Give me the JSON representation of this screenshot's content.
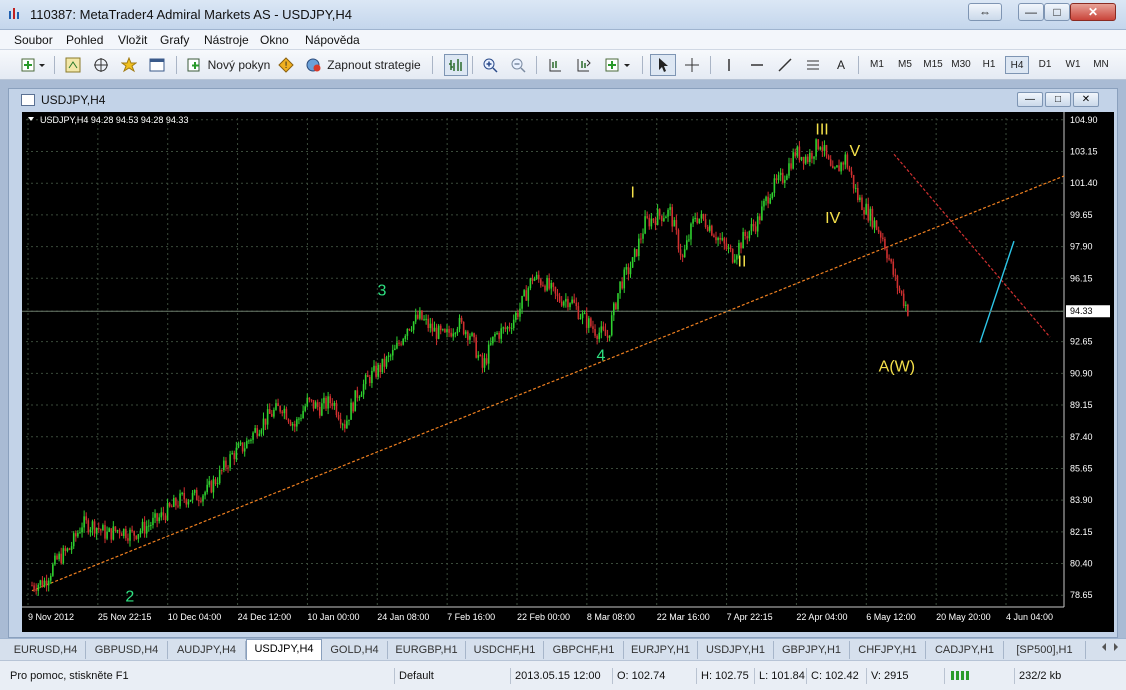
{
  "window": {
    "title": "110387: MetaTrader4 Admiral Markets AS - USDJPY,H4",
    "restore_glyph": "⇔",
    "min_glyph": "—",
    "max_glyph": "□",
    "close_glyph": "✕"
  },
  "menu": [
    "Soubor",
    "Pohled",
    "Vložit",
    "Grafy",
    "Nástroje",
    "Okno",
    "Nápověda"
  ],
  "toolbar": {
    "new_order": "Nový pokyn",
    "strategy": "Zapnout strategie",
    "text_tool": "A",
    "timeframes": [
      "M1",
      "M5",
      "M15",
      "M30",
      "H1",
      "H4",
      "D1",
      "W1",
      "MN"
    ],
    "active_timeframe": "H4"
  },
  "chart_window": {
    "title": "USDJPY,H4",
    "min_glyph": "—",
    "max_glyph": "□",
    "close_glyph": "✕"
  },
  "chart_data": {
    "type": "line",
    "symbol_header": "USDJPY,H4  94.28 94.53 94.28 94.33",
    "current_price": "94.33",
    "ylim": [
      78.0,
      105.0
    ],
    "y_ticks": [
      "104.90",
      "103.15",
      "101.40",
      "99.65",
      "97.90",
      "96.15",
      "94.33",
      "92.65",
      "90.90",
      "89.15",
      "87.40",
      "85.65",
      "83.90",
      "82.15",
      "80.40",
      "78.65"
    ],
    "x_ticks": [
      "9 Nov 2012",
      "25 Nov 22:15",
      "10 Dec 04:00",
      "24 Dec 12:00",
      "10 Jan 00:00",
      "24 Jan 08:00",
      "7 Feb 16:00",
      "22 Feb 00:00",
      "8 Mar 08:00",
      "22 Mar 16:00",
      "7 Apr 22:15",
      "22 Apr 04:00",
      "6 May 12:00",
      "20 May 20:00",
      "4 Jun 04:00"
    ],
    "series": [
      {
        "values": [
          79.2,
          79.4,
          80.6,
          81.2,
          82.6,
          82.5,
          82.0,
          82.3,
          82.0,
          82.4,
          82.8,
          83.4,
          84.0,
          84.1,
          84.4,
          85.3,
          86.4,
          86.9,
          87.9,
          88.6,
          89.1,
          88.0,
          89.3,
          89.0,
          89.4,
          88.1,
          89.8,
          90.7,
          91.3,
          92.1,
          93.5,
          94.0,
          93.3,
          92.9,
          93.7,
          93.1,
          91.2,
          93.0,
          93.4,
          94.5,
          96.2,
          95.9,
          95.0,
          95.0,
          94.0,
          93.3,
          92.9,
          95.8,
          97.0,
          99.2,
          99.6,
          99.8,
          97.2,
          99.6,
          99.2,
          98.2,
          97.4,
          98.5,
          99.3,
          101.0,
          101.7,
          103.1,
          102.8,
          103.7,
          101.8,
          102.8,
          100.6,
          99.6,
          98.4,
          96.0,
          94.4
        ]
      }
    ],
    "labels": [
      {
        "text": "2",
        "color": "#2ee080"
      },
      {
        "text": "3",
        "color": "#2ee080"
      },
      {
        "text": "4",
        "color": "#2ee080"
      },
      {
        "text": "I",
        "color": "#f4e04a"
      },
      {
        "text": "II",
        "color": "#f4e04a"
      },
      {
        "text": "III",
        "color": "#f4e04a"
      },
      {
        "text": "IV",
        "color": "#f4e04a"
      },
      {
        "text": "V",
        "color": "#f4e04a"
      },
      {
        "text": "A(W)",
        "color": "#f4e04a"
      }
    ],
    "grid": true,
    "colors": {
      "background": "#000000",
      "candle_up": "#2fd12f",
      "candle_down": "#d03030",
      "trendline": "#f08020",
      "projection": "#2cc6e8",
      "grid": "#3a4a3a",
      "label_green": "#2ee080",
      "label_yellow": "#f4e04a"
    }
  },
  "symbol_tabs": [
    "EURUSD,H4",
    "GBPUSD,H4",
    "AUDJPY,H4",
    "USDJPY,H4",
    "GOLD,H4",
    "EURGBP,H1",
    "USDCHF,H1",
    "GBPCHF,H1",
    "EURJPY,H1",
    "USDJPY,H1",
    "GBPJPY,H1",
    "CHFJPY,H1",
    "CADJPY,H1",
    "[SP500],H1"
  ],
  "active_tab": "USDJPY,H4",
  "status": {
    "help": "Pro pomoc, stiskněte F1",
    "profile": "Default",
    "datetime": "2013.05.15 12:00",
    "open": "O: 102.74",
    "high": "H: 102.75",
    "low": "L: 101.84",
    "close": "C: 102.42",
    "volume": "V: 2915",
    "traffic": "232/2 kb"
  }
}
